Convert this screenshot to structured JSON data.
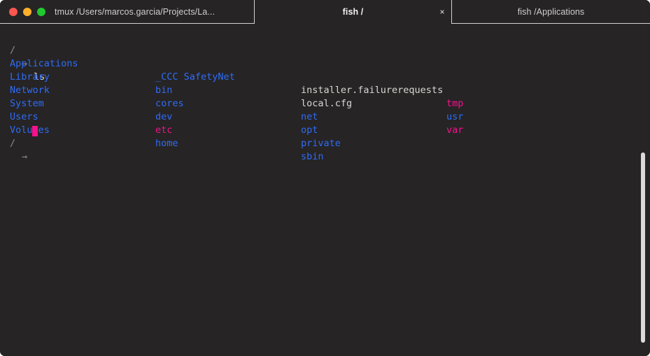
{
  "window": {
    "traffic_lights": [
      {
        "name": "close",
        "color": "#f9574f"
      },
      {
        "name": "minimize",
        "color": "#fbb02c"
      },
      {
        "name": "zoom",
        "color": "#1fc92f"
      }
    ]
  },
  "tabs": [
    {
      "label": "tmux /Users/marcos.garcia/Projects/La...",
      "active": false,
      "closable": false
    },
    {
      "label": "fish /",
      "active": true,
      "closable": true,
      "close_label": "×"
    },
    {
      "label": "fish /Applications",
      "active": false,
      "closable": false
    }
  ],
  "terminal": {
    "prompt": {
      "path": "/",
      "arrow": "→",
      "command": "ls"
    },
    "prompt_next": {
      "path": "/",
      "arrow": "→"
    },
    "colors": {
      "background": "#262425",
      "directory": "#2f6cf6",
      "symlink": "#f5128c",
      "file": "#d9d6d3",
      "prompt_dim": "#908d8a"
    },
    "listing_columns": [
      {
        "entries": [
          {
            "name": "Applications",
            "kind": "directory"
          },
          {
            "name": "Library",
            "kind": "directory"
          },
          {
            "name": "Network",
            "kind": "directory"
          },
          {
            "name": "System",
            "kind": "directory"
          },
          {
            "name": "Users",
            "kind": "directory"
          },
          {
            "name": "Volumes",
            "kind": "directory"
          }
        ]
      },
      {
        "entries": [
          {
            "name": "_CCC SafetyNet",
            "kind": "directory"
          },
          {
            "name": "bin",
            "kind": "directory"
          },
          {
            "name": "cores",
            "kind": "directory"
          },
          {
            "name": "dev",
            "kind": "directory"
          },
          {
            "name": "etc",
            "kind": "symlink"
          },
          {
            "name": "home",
            "kind": "directory"
          }
        ]
      },
      {
        "entries": [
          {
            "name": "installer.failurerequests",
            "kind": "file"
          },
          {
            "name": "local.cfg",
            "kind": "file"
          },
          {
            "name": "net",
            "kind": "directory"
          },
          {
            "name": "opt",
            "kind": "directory"
          },
          {
            "name": "private",
            "kind": "directory"
          },
          {
            "name": "sbin",
            "kind": "directory"
          }
        ]
      },
      {
        "entries": [
          {
            "name": "tmp",
            "kind": "symlink"
          },
          {
            "name": "usr",
            "kind": "directory"
          },
          {
            "name": "var",
            "kind": "symlink"
          }
        ]
      }
    ]
  },
  "scrollbar": {
    "name": "vertical-scrollbar"
  }
}
